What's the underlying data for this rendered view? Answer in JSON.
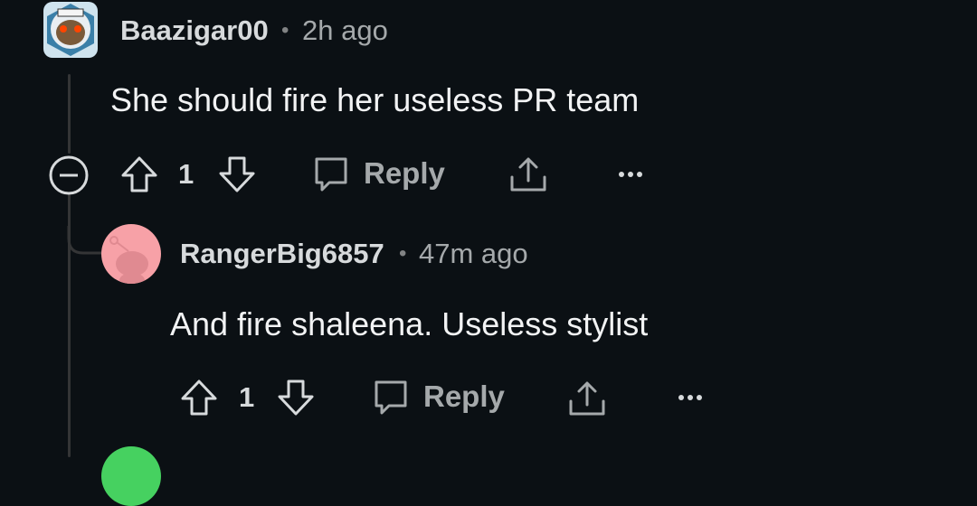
{
  "comments": [
    {
      "username": "Baazigar00",
      "separator": "•",
      "time": "2h ago",
      "body": "She should fire her useless PR team",
      "votes": "1",
      "reply_label": "Reply",
      "avatar_icon": "snoo-avatar-icon"
    },
    {
      "username": "RangerBig6857",
      "separator": "•",
      "time": "47m ago",
      "body": "And fire shaleena. Useless stylist",
      "votes": "1",
      "reply_label": "Reply",
      "avatar_icon": "default-snoo-avatar-icon"
    }
  ],
  "colors": {
    "background": "#0b1014",
    "thread_line": "#343536",
    "text": "#f2f3f4",
    "muted": "#a5a9ab",
    "pink_avatar": "#f7a1a7",
    "green_avatar": "#46d160"
  }
}
